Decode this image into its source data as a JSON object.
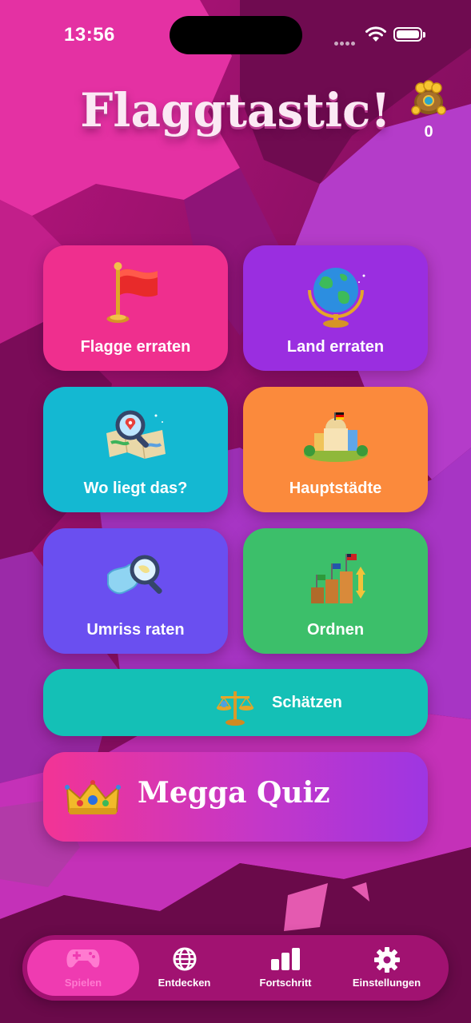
{
  "status_bar": {
    "time": "13:56"
  },
  "header": {
    "title": "Flaggtastic!",
    "coin_count": "0",
    "coin_icon": "coin-bag-icon"
  },
  "game_modes": [
    {
      "label": "Flagge erraten",
      "icon": "red-flag-icon",
      "color": "#ef2f8e"
    },
    {
      "label": "Land erraten",
      "icon": "globe-icon",
      "color": "#9a2ee0"
    },
    {
      "label": "Wo liegt das?",
      "icon": "map-magnifier-icon",
      "color": "#14b8d2"
    },
    {
      "label": "Hauptstädte",
      "icon": "capitol-building-icon",
      "color": "#fb8a3c"
    },
    {
      "label": "Umriss raten",
      "icon": "outline-magnifier-icon",
      "color": "#6a4ff0"
    },
    {
      "label": "Ordnen",
      "icon": "ranking-podium-icon",
      "color": "#3cbf6a"
    }
  ],
  "estimate_mode": {
    "label": "Schätzen",
    "icon": "scale-icon",
    "color": "#14c0b6"
  },
  "mega_quiz": {
    "label": "Megga Quiz",
    "icon": "crown-icon"
  },
  "tab_bar": [
    {
      "label": "Spielen",
      "icon": "gamepad-icon",
      "active": true
    },
    {
      "label": "Entdecken",
      "icon": "globe-grid-icon",
      "active": false
    },
    {
      "label": "Fortschritt",
      "icon": "bar-chart-icon",
      "active": false
    },
    {
      "label": "Einstellungen",
      "icon": "gear-icon",
      "active": false
    }
  ]
}
